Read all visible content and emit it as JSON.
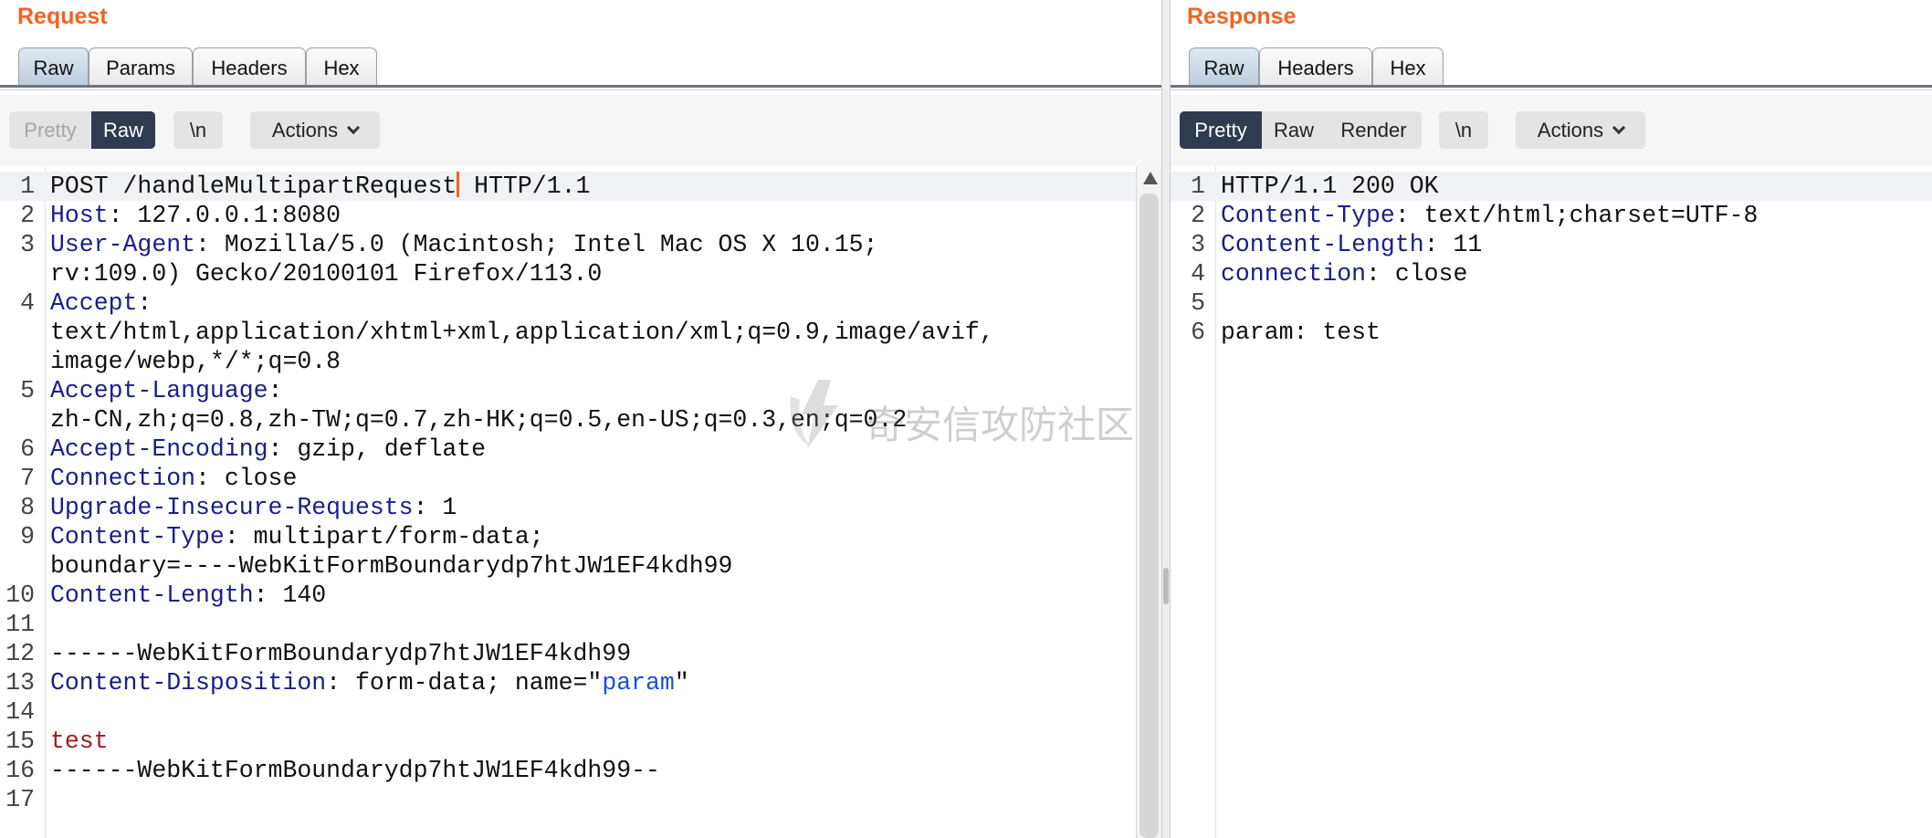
{
  "request": {
    "title": "Request",
    "tabs": [
      "Raw",
      "Params",
      "Headers",
      "Hex"
    ],
    "toolbar": {
      "pretty": "Pretty",
      "raw": "Raw",
      "newline": "\\n",
      "actions": "Actions"
    },
    "lines": [
      {
        "n": "1",
        "method": "POST /handleMultipartRequest",
        "rest": " HTTP/1.1"
      },
      {
        "n": "2",
        "key": "Host",
        "val": ": 127.0.0.1:8080"
      },
      {
        "n": "3",
        "key": "User-Agent",
        "val": ": Mozilla/5.0 (Macintosh; Intel Mac OS X 10.15;"
      },
      {
        "n": "",
        "val": "rv:109.0) Gecko/20100101 Firefox/113.0"
      },
      {
        "n": "4",
        "key": "Accept",
        "val": ":"
      },
      {
        "n": "",
        "val": "text/html,application/xhtml+xml,application/xml;q=0.9,image/avif,"
      },
      {
        "n": "",
        "val": "image/webp,*/*;q=0.8"
      },
      {
        "n": "5",
        "key": "Accept-Language",
        "val": ":"
      },
      {
        "n": "",
        "val": "zh-CN,zh;q=0.8,zh-TW;q=0.7,zh-HK;q=0.5,en-US;q=0.3,en;q=0.2"
      },
      {
        "n": "6",
        "key": "Accept-Encoding",
        "val": ": gzip, deflate"
      },
      {
        "n": "7",
        "key": "Connection",
        "val": ": close"
      },
      {
        "n": "8",
        "key": "Upgrade-Insecure-Requests",
        "val": ": 1"
      },
      {
        "n": "9",
        "key": "Content-Type",
        "val": ": multipart/form-data;"
      },
      {
        "n": "",
        "val": "boundary=----WebKitFormBoundarydp7htJW1EF4kdh99"
      },
      {
        "n": "10",
        "key": "Content-Length",
        "val": ": 140"
      },
      {
        "n": "11",
        "val": ""
      },
      {
        "n": "12",
        "val": "------WebKitFormBoundarydp7htJW1EF4kdh99"
      },
      {
        "n": "13",
        "key": "Content-Disposition",
        "val": ": form-data; name=\"",
        "pval": "param",
        "tail": "\""
      },
      {
        "n": "14",
        "val": ""
      },
      {
        "n": "15",
        "body": "test"
      },
      {
        "n": "16",
        "val": "------WebKitFormBoundarydp7htJW1EF4kdh99--"
      },
      {
        "n": "17",
        "val": ""
      }
    ]
  },
  "response": {
    "title": "Response",
    "tabs": [
      "Raw",
      "Headers",
      "Hex"
    ],
    "toolbar": {
      "pretty": "Pretty",
      "raw": "Raw",
      "render": "Render",
      "newline": "\\n",
      "actions": "Actions"
    },
    "lines": [
      {
        "n": "1",
        "val": "HTTP/1.1 200 OK"
      },
      {
        "n": "2",
        "key": "Content-Type",
        "val": ": text/html;charset=UTF-8"
      },
      {
        "n": "3",
        "key": "Content-Length",
        "val": ": 11"
      },
      {
        "n": "4",
        "key": "connection",
        "val": ": close"
      },
      {
        "n": "5",
        "val": ""
      },
      {
        "n": "6",
        "val": "param: test"
      }
    ]
  },
  "watermark": {
    "text": "奇安信攻防社区"
  },
  "colors": {
    "accent": "#f26322",
    "header_key": "#1a1f86",
    "param_value": "#1c4fd8",
    "body_value": "#a11b1b",
    "selected_button": "#2f3b50"
  }
}
